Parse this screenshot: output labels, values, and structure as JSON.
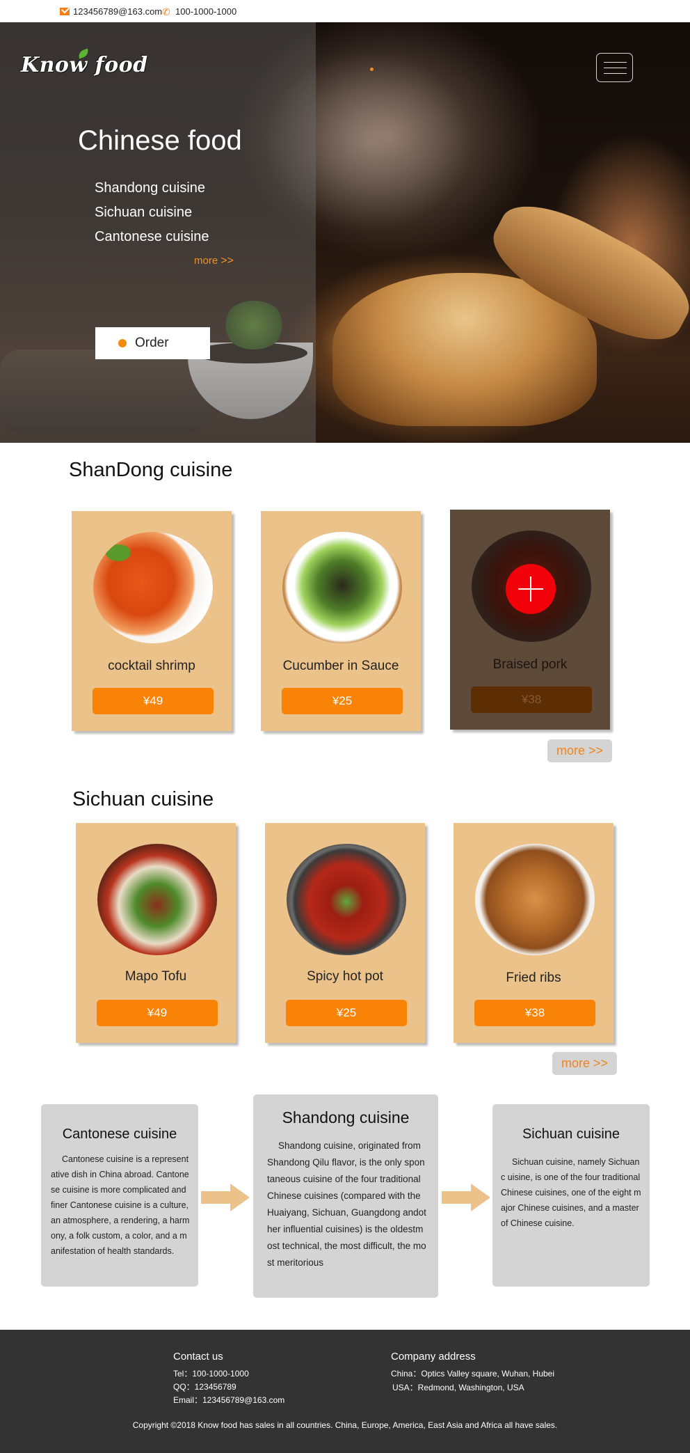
{
  "topbar": {
    "email": "123456789@163.com",
    "phone": "100-1000-1000"
  },
  "hero": {
    "logo": "Know food",
    "title": "Chinese food",
    "cuisines": [
      "Shandong cuisine",
      "Sichuan cuisine",
      "Cantonese cuisine"
    ],
    "more_label": "more",
    "more_arrows": ">>",
    "order_label": "Order"
  },
  "shandong": {
    "title": "ShanDong cuisine",
    "items": [
      {
        "name": "cocktail shrimp",
        "price": "¥49",
        "icon": "shrimp-photo"
      },
      {
        "name": "Cucumber in Sauce",
        "price": "¥25",
        "icon": "cucumber-photo"
      },
      {
        "name": "Braised pork",
        "price": "¥38",
        "icon": "pork-photo"
      }
    ],
    "more_label": "more >>"
  },
  "sichuan": {
    "title": "Sichuan cuisine",
    "items": [
      {
        "name": "Mapo Tofu",
        "price": "¥49",
        "icon": "tofu-photo"
      },
      {
        "name": "Spicy hot pot",
        "price": "¥25",
        "icon": "hotpot-photo"
      },
      {
        "name": "Fried ribs",
        "price": "¥38",
        "icon": "ribs-photo"
      }
    ],
    "more_label": "more >>"
  },
  "info": {
    "cantonese": {
      "title": "Cantonese cuisine",
      "text": "Cantonese cuisine is a representative dish in China abroad. Cantonese cuisine is more complicated and finer Cantonese cuisine is a culture,an atmosphere, a rendering, a harmony, a folk custom, a color, and a manifestation of health standards."
    },
    "shandong": {
      "title": "Shandong cuisine",
      "text": "Shandong cuisine, originated from Shandong Qilu flavor, is the only spontaneous cuisine of the four traditional Chinese cuisines (compared with the Huaiyang, Sichuan, Guangdong andother influential cuisines) is the oldestmost technical, the most difficult, the most meritorious"
    },
    "sichuan": {
      "title": "Sichuan cuisine",
      "text": "Sichuan cuisine, namely Sichuanc uisine, is one of the four traditionalChinese cuisines, one of the eight major Chinese cuisines, and a master of Chinese cuisine."
    }
  },
  "footer": {
    "contact_title": "Contact us",
    "tel": "Tel：100-1000-1000",
    "qq": "QQ：123456789",
    "email": "Email：123456789@163.com",
    "address_title": "Company address",
    "china": "China：Optics Valley square, Wuhan, Hubei",
    "usa": "USA：Redmond, Washington, USA",
    "copyright": "Copyright ©2018 Know food has sales in all countries. China, Europe, America, East Asia and Africa all have sales."
  },
  "colors": {
    "accent": "#f98306",
    "card": "#ecc28b",
    "card_active": "#5e4a39",
    "footer": "#333333",
    "plus": "#f2010b"
  }
}
